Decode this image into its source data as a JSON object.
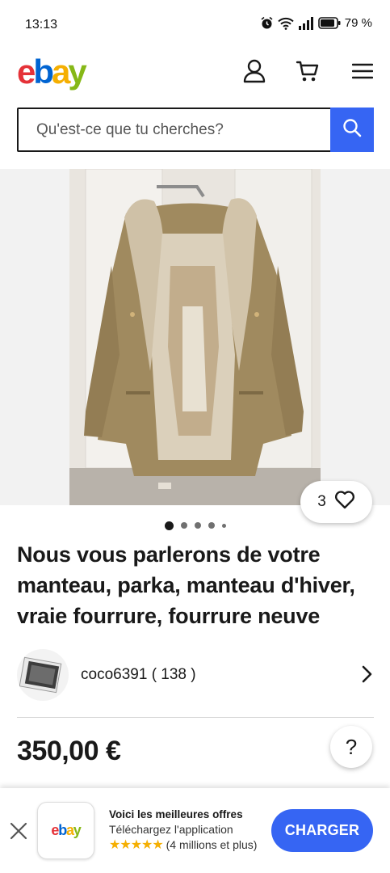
{
  "status_bar": {
    "time": "13:13",
    "battery": "79 %"
  },
  "header": {
    "logo_letters": [
      "e",
      "b",
      "a",
      "y"
    ],
    "brand_colors": {
      "e": "#e53238",
      "b": "#0064d2",
      "a": "#f5af02",
      "y": "#86b817"
    },
    "icons": [
      "account-icon",
      "cart-icon",
      "menu-icon"
    ]
  },
  "search": {
    "placeholder": "Qu'est-ce que tu cherches?",
    "button_icon": "search-icon",
    "accent_color": "#3665f3"
  },
  "gallery": {
    "watch_count": "3",
    "image_count": 5,
    "active_index": 0
  },
  "listing": {
    "title": "Nous vous parlerons de votre manteau, parka, manteau d'hiver, vraie fourrure, fourrure neuve",
    "seller_name": "coco6391",
    "seller_feedback": "( 138 )",
    "price": "350,00 €",
    "help_label": "?"
  },
  "app_banner": {
    "title": "Voici les meilleures offres",
    "subtitle": "Téléchargez l'application",
    "stars": "★★★★★",
    "rating_text": "(4 millions et plus)",
    "cta": "CHARGER"
  }
}
